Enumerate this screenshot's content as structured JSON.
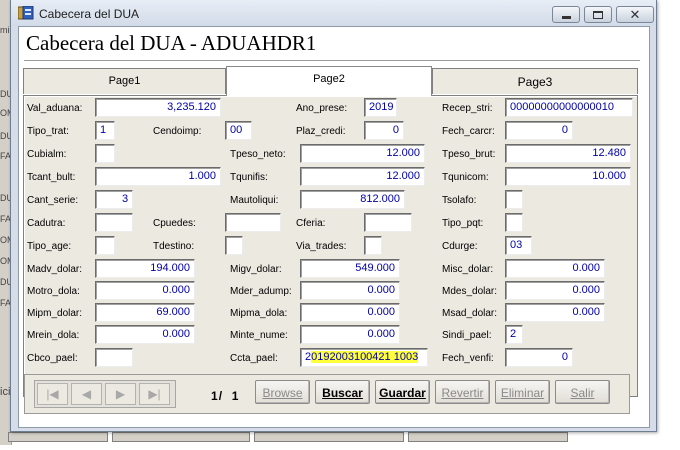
{
  "background": {
    "fragments": [
      "mi",
      "DU",
      "OM",
      "DU",
      "FA",
      "DU",
      "FA",
      "OM",
      "OM",
      "DU",
      "FA"
    ],
    "bottom_text": "ici"
  },
  "window": {
    "title": "Cabecera del DUA",
    "heading": "Cabecera del DUA - ADUAHDR1",
    "controls": [
      "minimize",
      "maximize",
      "close"
    ]
  },
  "tabs": [
    {
      "label": "Page1",
      "active": false
    },
    {
      "label": "Page2",
      "active": true
    },
    {
      "label": "Page3",
      "active": false
    }
  ],
  "form": {
    "val_aduana": {
      "label": "Val_aduana:",
      "value": "3,235.120"
    },
    "ano_prese": {
      "label": "Ano_prese:",
      "value": "2019"
    },
    "recep_stri": {
      "label": "Recep_stri:",
      "value": "00000000000000010"
    },
    "tipo_trat": {
      "label": "Tipo_trat:",
      "value": "1"
    },
    "cendoimp": {
      "label": "Cendoimp:",
      "value": "00"
    },
    "plaz_credi": {
      "label": "Plaz_credi:",
      "value": "0"
    },
    "fech_carcr": {
      "label": "Fech_carcr:",
      "value": "0"
    },
    "cubialm": {
      "label": "Cubialm:",
      "value": ""
    },
    "tpeso_neto": {
      "label": "Tpeso_neto:",
      "value": "12.000"
    },
    "tpeso_brut": {
      "label": "Tpeso_brut:",
      "value": "12.480"
    },
    "tcant_bult": {
      "label": "Tcant_bult:",
      "value": "1.000"
    },
    "tqunifis": {
      "label": "Tqunifis:",
      "value": "12.000"
    },
    "tqunicom": {
      "label": "Tqunicom:",
      "value": "10.000"
    },
    "cant_serie": {
      "label": "Cant_serie:",
      "value": "3"
    },
    "mautoliqui": {
      "label": "Mautoliqui:",
      "value": "812.000"
    },
    "tsolafo": {
      "label": "Tsolafo:",
      "value": ""
    },
    "cadutra": {
      "label": "Cadutra:",
      "value": ""
    },
    "cpuedes": {
      "label": "Cpuedes:",
      "value": ""
    },
    "cferia": {
      "label": "Cferia:",
      "value": ""
    },
    "tipo_pqt": {
      "label": "Tipo_pqt:",
      "value": ""
    },
    "tipo_age": {
      "label": "Tipo_age:",
      "value": ""
    },
    "tdestino": {
      "label": "Tdestino:",
      "value": ""
    },
    "via_trades": {
      "label": "Via_trades:",
      "value": ""
    },
    "cdurge": {
      "label": "Cdurge:",
      "value": "03"
    },
    "madv_dolar": {
      "label": "Madv_dolar:",
      "value": "194.000"
    },
    "migv_dolar": {
      "label": "Migv_dolar:",
      "value": "549.000"
    },
    "misc_dolar": {
      "label": "Misc_dolar:",
      "value": "0.000"
    },
    "motro_dola": {
      "label": "Motro_dola:",
      "value": "0.000"
    },
    "mder_adump": {
      "label": "Mder_adump:",
      "value": "0.000"
    },
    "mdes_dolar": {
      "label": "Mdes_dolar:",
      "value": "0.000"
    },
    "mipm_dolar": {
      "label": "Mipm_dolar:",
      "value": "69.000"
    },
    "mipma_dola": {
      "label": "Mipma_dola:",
      "value": "0.000"
    },
    "msad_dolar": {
      "label": "Msad_dolar:",
      "value": "0.000"
    },
    "mrein_dola": {
      "label": "Mrein_dola:",
      "value": "0.000"
    },
    "minte_nume": {
      "label": "Minte_nume:",
      "value": "0.000"
    },
    "sindi_pael": {
      "label": "Sindi_pael:",
      "value": "2"
    },
    "cbco_pael": {
      "label": "Cbco_pael:",
      "value": ""
    },
    "ccta_pael": {
      "label": "Ccta_pael:",
      "value_prefix": "2",
      "value_highlight": "0192003100421 1003",
      "highlight_color": "#ffff3a"
    },
    "fech_venfi": {
      "label": "Fech_venfi:",
      "value": "0"
    }
  },
  "navigation": {
    "page_current": "1",
    "page_separator": "/",
    "page_total": "1",
    "buttons": {
      "first": "first-record-icon",
      "prev": "previous-record-icon",
      "next": "next-record-icon",
      "last": "last-record-icon"
    },
    "actions": {
      "browse": "Browse",
      "buscar": "Buscar",
      "guardar": "Guardar",
      "revertir": "Revertir",
      "eliminar": "Eliminar",
      "salir": "Salir"
    }
  },
  "colors": {
    "field_text": "#0000a8",
    "highlight": "#ffff3a",
    "panel": "#ece9e1"
  }
}
